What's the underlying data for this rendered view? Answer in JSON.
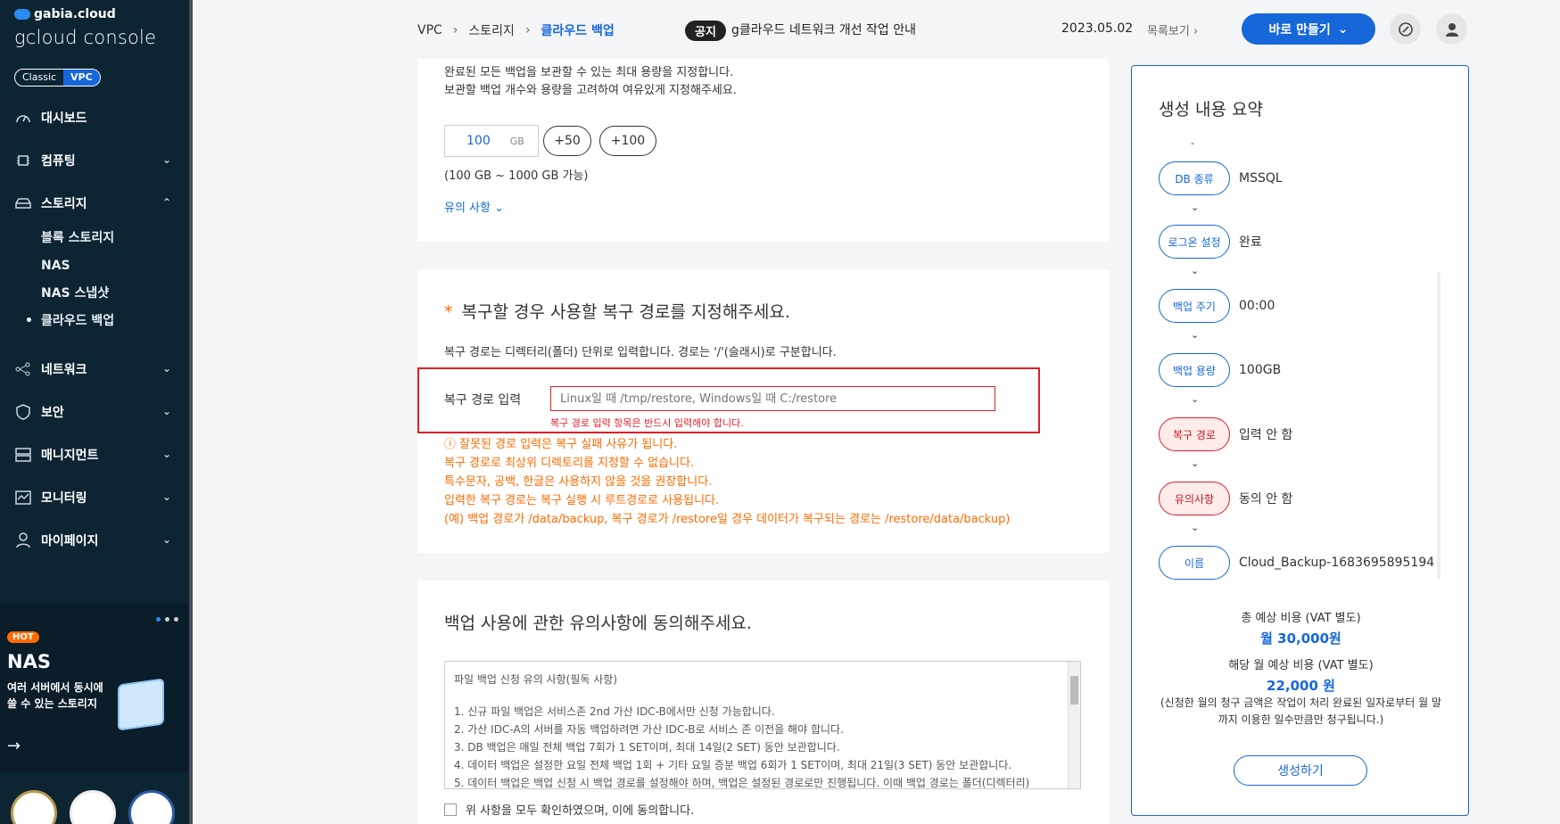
{
  "sidebar": {
    "brand_small": "gabia.cloud",
    "brand_big": "gcloud console",
    "modes": [
      "Classic",
      "VPC"
    ],
    "items": [
      {
        "label": "대시보드"
      },
      {
        "label": "컴퓨팅"
      },
      {
        "label": "스토리지",
        "subs": [
          "블록 스토리지",
          "NAS",
          "NAS 스냅샷",
          "클라우드 백업"
        ]
      },
      {
        "label": "네트워크"
      },
      {
        "label": "보안"
      },
      {
        "label": "매니지먼트"
      },
      {
        "label": "모니터링"
      },
      {
        "label": "마이페이지"
      }
    ],
    "promo": {
      "badge": "HOT",
      "title": "NAS",
      "desc": "여러 서버에서 동시에 쓸 수 있는 스토리지",
      "arrow": "→"
    }
  },
  "header": {
    "breadcrumb": [
      "VPC",
      "스토리지",
      "클라우드 백업"
    ],
    "notice_tag": "공지",
    "notice_text": "g클라우드 네트워크 개선 작업 안내",
    "notice_date": "2023.05.02",
    "notice_more": "목록보기 ›",
    "create_button": "바로 만들기"
  },
  "capacity": {
    "desc1": "완료된 모든 백업을 보관할 수 있는 최대 용량을 지정합니다.",
    "desc2": "보관할 백업 개수와 용량을 고려하여 여유있게 지정해주세요.",
    "value": "100",
    "unit": "GB",
    "btn50": "+50",
    "btn100": "+100",
    "range": "(100 GB ~ 1000 GB 가능)",
    "notes_link": "유의 사항 ⌄"
  },
  "restore": {
    "required": "*",
    "title": "복구할 경우 사용할 복구 경로를 지정해주세요.",
    "desc": "복구 경로는 디렉터리(폴더) 단위로 입력합니다. 경로는 '/'(슬래시)로 구분합니다.",
    "label": "복구 경로 입력",
    "placeholder": "Linux일 때 /tmp/restore, Windows일 때 C:/restore",
    "error": "복구 경로 입력 항목은 반드시 입력해야 합니다.",
    "warnings": [
      "ⓘ 잘못된 경로 입력은 복구 실패 사유가 됩니다.",
      "복구 경로로 최상위 디렉토리를 지정할 수 없습니다.",
      "특수문자, 공백, 한글은 사용하지 않을 것을 권장합니다.",
      "입력한 복구 경로는 복구 실행 시 루트경로로 사용됩니다.",
      "(예) 백업 경로가 /data/backup, 복구 경로가 /restore일 경우 데이터가 복구되는 경로는 /restore/data/backup)"
    ]
  },
  "terms": {
    "title": "백업 사용에 관한 유의사항에 동의해주세요.",
    "lines": [
      "파일 백업 신청 유의 사항(필독 사항)",
      "",
      "1. 신규 파일 백업은 서비스존 2nd 가산 IDC-B에서만 신청 가능합니다.",
      "2. 가산 IDC-A의 서버를 자동 백업하려면 가산 IDC-B로 서비스 존 이전을 해야 합니다.",
      "3. DB 백업은 매일 전체 백업 7회가 1 SET이며, 최대 14일(2 SET) 동안 보관합니다.",
      "4. 데이터 백업은 설정한 요일 전체 백업 1회 + 기타 요일 증분 백업 6회가 1 SET이며, 최대 21일(3 SET) 동안 보관합니다.",
      "5. 데이터 백업은 백업 신청 시 백업 경로를 설정해야 하며, 백업은 설정된 경로로만 진행됩니다. 이때 백업 경로는 폴더(디렉터리)"
    ],
    "agree": "위 사항을 모두 확인하였으며, 이에 동의합니다."
  },
  "summary": {
    "title": "생성 내용 요약",
    "top_mark": "-",
    "arrow": "⌄",
    "rows": [
      {
        "chip": "DB 종류",
        "value": "MSSQL",
        "state": "ok"
      },
      {
        "chip": "로그온 설정",
        "value": "완료",
        "state": "ok"
      },
      {
        "chip": "백업 주기",
        "value": "00:00",
        "state": "ok"
      },
      {
        "chip": "백업 용량",
        "value": "100GB",
        "state": "ok"
      },
      {
        "chip": "복구 경로",
        "value": "입력 안 함",
        "state": "bad"
      },
      {
        "chip": "유의사항",
        "value": "동의 안 함",
        "state": "bad"
      },
      {
        "chip": "이름",
        "value": "Cloud_Backup-1683695895194",
        "state": "ok"
      }
    ],
    "total_label": "총 예상 비용 (VAT 별도)",
    "total_value": "월 30,000원",
    "month_label": "해당 월 예상 비용 (VAT 별도)",
    "month_value": "22,000 원",
    "note": "(신청한 월의 청구 금액은 작업이 처리 완료된 일자로부터 월 말까지 이용한 일수만큼만 청구됩니다.)",
    "create_button": "생성하기"
  },
  "colors": {
    "primary": "#1667d9",
    "error": "#e01e27",
    "warning": "#ff6a00",
    "sidebar": "#0d2533"
  }
}
